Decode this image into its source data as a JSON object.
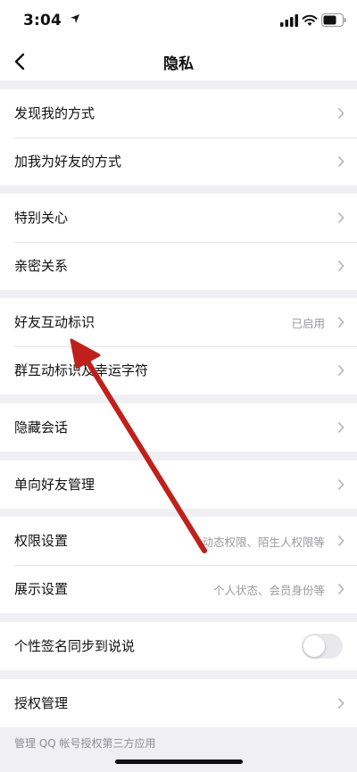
{
  "status_bar": {
    "time": "3:04"
  },
  "nav": {
    "title": "隐私"
  },
  "groups": [
    {
      "rows": [
        {
          "label": "发现我的方式"
        },
        {
          "label": "加我为好友的方式"
        }
      ]
    },
    {
      "rows": [
        {
          "label": "特别关心"
        },
        {
          "label": "亲密关系"
        }
      ]
    },
    {
      "rows": [
        {
          "label": "好友互动标识",
          "value": "已启用"
        },
        {
          "label": "群互动标识及幸运字符"
        }
      ]
    },
    {
      "rows": [
        {
          "label": "隐藏会话"
        }
      ]
    },
    {
      "rows": [
        {
          "label": "单向好友管理"
        }
      ]
    },
    {
      "rows": [
        {
          "label": "权限设置",
          "value": "动态权限、陌生人权限等"
        },
        {
          "label": "展示设置",
          "value": "个人状态、会员身份等"
        }
      ]
    },
    {
      "rows": [
        {
          "label": "个性签名同步到说说",
          "toggle_on": false
        }
      ]
    },
    {
      "rows": [
        {
          "label": "授权管理"
        }
      ]
    }
  ],
  "footer_note": "管理 QQ 帐号授权第三方应用",
  "annotation": {
    "type": "arrow",
    "color": "#c0201b"
  }
}
